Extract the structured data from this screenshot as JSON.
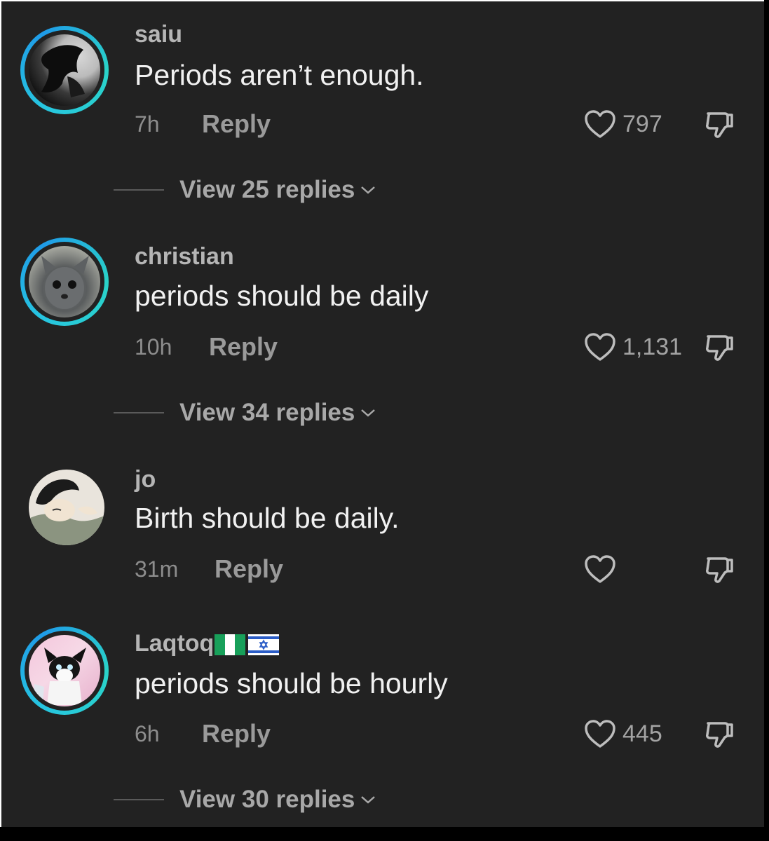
{
  "comments": [
    {
      "username": "saiu",
      "text": "Periods aren’t enough.",
      "time": "7h",
      "reply_label": "Reply",
      "likes": "797",
      "view_replies": "View 25 replies"
    },
    {
      "username": "christian",
      "text": "periods should be daily",
      "time": "10h",
      "reply_label": "Reply",
      "likes": "1,131",
      "view_replies": "View 34 replies"
    },
    {
      "username": "jo",
      "text": "Birth should be daily.",
      "time": "31m",
      "reply_label": "Reply",
      "likes": ""
    },
    {
      "username": "Laqtoq",
      "username_flags": [
        "nigeria-flag",
        "israel-flag"
      ],
      "text": "periods should be hourly",
      "time": "6h",
      "reply_label": "Reply",
      "likes": "445",
      "view_replies": "View 30 replies"
    }
  ],
  "icons": {
    "like": "heart-outline-icon",
    "dislike": "thumbs-down-icon",
    "expand": "chevron-down-icon"
  },
  "colors": {
    "background": "#222222",
    "story_ring": "#27c6e0",
    "primary_text": "#f1f1f1",
    "secondary_text": "#9a9a9a"
  }
}
